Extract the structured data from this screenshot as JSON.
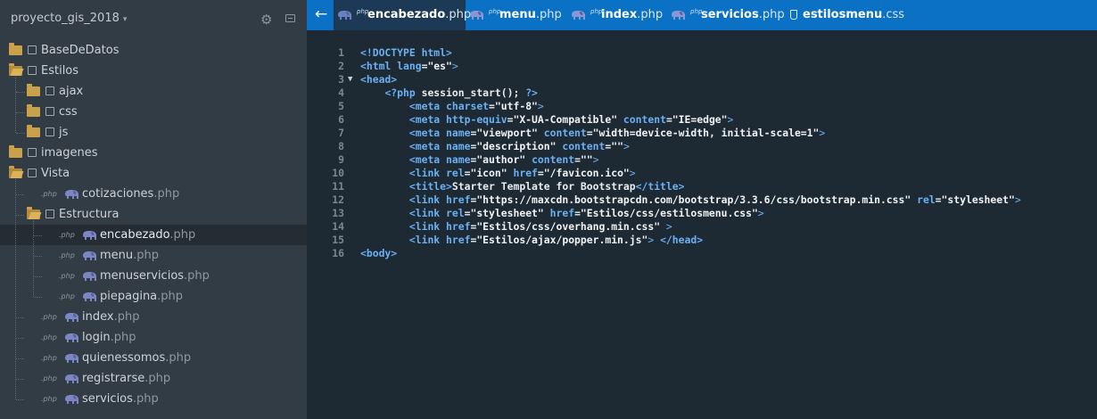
{
  "sidebar": {
    "project_title": "proyecto_gis_2018",
    "caret": "▾",
    "gear": "⚙",
    "php_tag": ".php",
    "items": [
      {
        "name": "BaseDeDatos",
        "ext": "",
        "type": "folder",
        "depth": 0
      },
      {
        "name": "Estilos",
        "ext": "",
        "type": "folder-open",
        "depth": 0
      },
      {
        "name": "ajax",
        "ext": "",
        "type": "folder",
        "depth": 1
      },
      {
        "name": "css",
        "ext": "",
        "type": "folder",
        "depth": 1
      },
      {
        "name": "js",
        "ext": "",
        "type": "folder",
        "depth": 1
      },
      {
        "name": "imagenes",
        "ext": "",
        "type": "folder",
        "depth": 0
      },
      {
        "name": "Vista",
        "ext": "",
        "type": "folder-open",
        "depth": 0
      },
      {
        "name": "cotizaciones",
        "ext": ".php",
        "type": "php",
        "depth": 1
      },
      {
        "name": "Estructura",
        "ext": "",
        "type": "folder-open",
        "depth": 1
      },
      {
        "name": "encabezado",
        "ext": ".php",
        "type": "php",
        "depth": 2,
        "selected": true
      },
      {
        "name": "menu",
        "ext": ".php",
        "type": "php",
        "depth": 2
      },
      {
        "name": "menuservicios",
        "ext": ".php",
        "type": "php",
        "depth": 2
      },
      {
        "name": "piepagina",
        "ext": ".php",
        "type": "php",
        "depth": 2
      },
      {
        "name": "index",
        "ext": ".php",
        "type": "php",
        "depth": 1
      },
      {
        "name": "login",
        "ext": ".php",
        "type": "php",
        "depth": 1
      },
      {
        "name": "quienessomos",
        "ext": ".php",
        "type": "php",
        "depth": 1
      },
      {
        "name": "registrarse",
        "ext": ".php",
        "type": "php",
        "depth": 1
      },
      {
        "name": "servicios",
        "ext": ".php",
        "type": "php",
        "depth": 1
      }
    ]
  },
  "tabs": {
    "back_arrow": "←",
    "items": [
      {
        "base": "encabezado",
        "ext": ".php",
        "kind": "php",
        "mini": "php",
        "active": true
      },
      {
        "base": "menu",
        "ext": ".php",
        "kind": "php",
        "mini": "php"
      },
      {
        "base": "index",
        "ext": ".php",
        "kind": "php",
        "mini": "php"
      },
      {
        "base": "servicios",
        "ext": ".php",
        "kind": "php",
        "mini": "php"
      },
      {
        "base": "estilosmenu",
        "ext": ".css",
        "kind": "css"
      }
    ]
  },
  "editor": {
    "fold_marker": "▼",
    "lines": [
      {
        "n": "1",
        "tokens": [
          [
            "kw",
            "<!DOCTYPE html>"
          ]
        ]
      },
      {
        "n": "2",
        "tokens": [
          [
            "kw",
            "<html "
          ],
          [
            "at",
            "lang"
          ],
          [
            "pl",
            "="
          ],
          [
            "st",
            "\"es\""
          ],
          [
            "br",
            ">"
          ]
        ]
      },
      {
        "n": "3",
        "fold": true,
        "tokens": [
          [
            "kw",
            "<head>"
          ]
        ]
      },
      {
        "n": "4",
        "tokens": [
          [
            "pl",
            "    "
          ],
          [
            "kw",
            "<?php"
          ],
          [
            "pl",
            " session_start(); "
          ],
          [
            "kw",
            "?>"
          ]
        ]
      },
      {
        "n": "5",
        "tokens": [
          [
            "pl",
            "        "
          ],
          [
            "kw",
            "<meta "
          ],
          [
            "at",
            "charset"
          ],
          [
            "pl",
            "="
          ],
          [
            "st",
            "\"utf-8\""
          ],
          [
            "br",
            ">"
          ]
        ]
      },
      {
        "n": "6",
        "tokens": [
          [
            "pl",
            "        "
          ],
          [
            "kw",
            "<meta "
          ],
          [
            "at",
            "http-equiv"
          ],
          [
            "pl",
            "="
          ],
          [
            "st",
            "\"X-UA-Compatible\""
          ],
          [
            "pl",
            " "
          ],
          [
            "at",
            "content"
          ],
          [
            "pl",
            "="
          ],
          [
            "st",
            "\"IE=edge\""
          ],
          [
            "br",
            ">"
          ]
        ]
      },
      {
        "n": "7",
        "tokens": [
          [
            "pl",
            "        "
          ],
          [
            "kw",
            "<meta "
          ],
          [
            "at",
            "name"
          ],
          [
            "pl",
            "="
          ],
          [
            "st",
            "\"viewport\""
          ],
          [
            "pl",
            " "
          ],
          [
            "at",
            "content"
          ],
          [
            "pl",
            "="
          ],
          [
            "st",
            "\"width=device-width, initial-scale=1\""
          ],
          [
            "br",
            ">"
          ]
        ]
      },
      {
        "n": "8",
        "tokens": [
          [
            "pl",
            "        "
          ],
          [
            "kw",
            "<meta "
          ],
          [
            "at",
            "name"
          ],
          [
            "pl",
            "="
          ],
          [
            "st",
            "\"description\""
          ],
          [
            "pl",
            " "
          ],
          [
            "at",
            "content"
          ],
          [
            "pl",
            "="
          ],
          [
            "st",
            "\"\""
          ],
          [
            "br",
            ">"
          ]
        ]
      },
      {
        "n": "9",
        "tokens": [
          [
            "pl",
            "        "
          ],
          [
            "kw",
            "<meta "
          ],
          [
            "at",
            "name"
          ],
          [
            "pl",
            "="
          ],
          [
            "st",
            "\"author\""
          ],
          [
            "pl",
            " "
          ],
          [
            "at",
            "content"
          ],
          [
            "pl",
            "="
          ],
          [
            "st",
            "\"\""
          ],
          [
            "br",
            ">"
          ]
        ]
      },
      {
        "n": "10",
        "tokens": [
          [
            "pl",
            "        "
          ],
          [
            "kw",
            "<link "
          ],
          [
            "at",
            "rel"
          ],
          [
            "pl",
            "="
          ],
          [
            "st",
            "\"icon\""
          ],
          [
            "pl",
            " "
          ],
          [
            "at",
            "href"
          ],
          [
            "pl",
            "="
          ],
          [
            "st",
            "\"/favicon.ico\""
          ],
          [
            "br",
            ">"
          ]
        ]
      },
      {
        "n": "11",
        "tokens": [
          [
            "pl",
            "        "
          ],
          [
            "kw",
            "<title>"
          ],
          [
            "pl",
            "Starter Template for Bootstrap"
          ],
          [
            "kw",
            "</title>"
          ]
        ]
      },
      {
        "n": "12",
        "tokens": [
          [
            "pl",
            "        "
          ],
          [
            "kw",
            "<link "
          ],
          [
            "at",
            "href"
          ],
          [
            "pl",
            "="
          ],
          [
            "st",
            "\"https://maxcdn.bootstrapcdn.com/bootstrap/3.3.6/css/bootstrap.min.css\""
          ],
          [
            "pl",
            " "
          ],
          [
            "at",
            "rel"
          ],
          [
            "pl",
            "="
          ],
          [
            "st",
            "\"stylesheet\""
          ],
          [
            "br",
            ">"
          ]
        ]
      },
      {
        "n": "13",
        "tokens": [
          [
            "pl",
            "        "
          ],
          [
            "kw",
            "<link "
          ],
          [
            "at",
            "rel"
          ],
          [
            "pl",
            "="
          ],
          [
            "st",
            "\"stylesheet\""
          ],
          [
            "pl",
            " "
          ],
          [
            "at",
            "href"
          ],
          [
            "pl",
            "="
          ],
          [
            "st",
            "\"Estilos/css/estilosmenu.css\""
          ],
          [
            "br",
            ">"
          ]
        ]
      },
      {
        "n": "14",
        "tokens": [
          [
            "pl",
            "        "
          ],
          [
            "kw",
            "<link "
          ],
          [
            "at",
            "href"
          ],
          [
            "pl",
            "="
          ],
          [
            "st",
            "\"Estilos/css/overhang.min.css\""
          ],
          [
            "pl",
            " "
          ],
          [
            "br",
            ">"
          ]
        ]
      },
      {
        "n": "15",
        "tokens": [
          [
            "pl",
            "        "
          ],
          [
            "kw",
            "<link "
          ],
          [
            "at",
            "href"
          ],
          [
            "pl",
            "="
          ],
          [
            "st",
            "\"Estilos/ajax/popper.min.js\""
          ],
          [
            "br",
            ">"
          ],
          [
            "pl",
            " "
          ],
          [
            "kw",
            "</head>"
          ]
        ]
      },
      {
        "n": "16",
        "tokens": [
          [
            "kw",
            "<body>"
          ]
        ]
      }
    ]
  },
  "colors": {
    "tabbar": "#0b71c4",
    "active_tab": "#1c3a55",
    "sidebar": "#323c44",
    "editor": "#1e2a33",
    "folder": "#c9a14b",
    "elephant": "#7d86c4"
  }
}
